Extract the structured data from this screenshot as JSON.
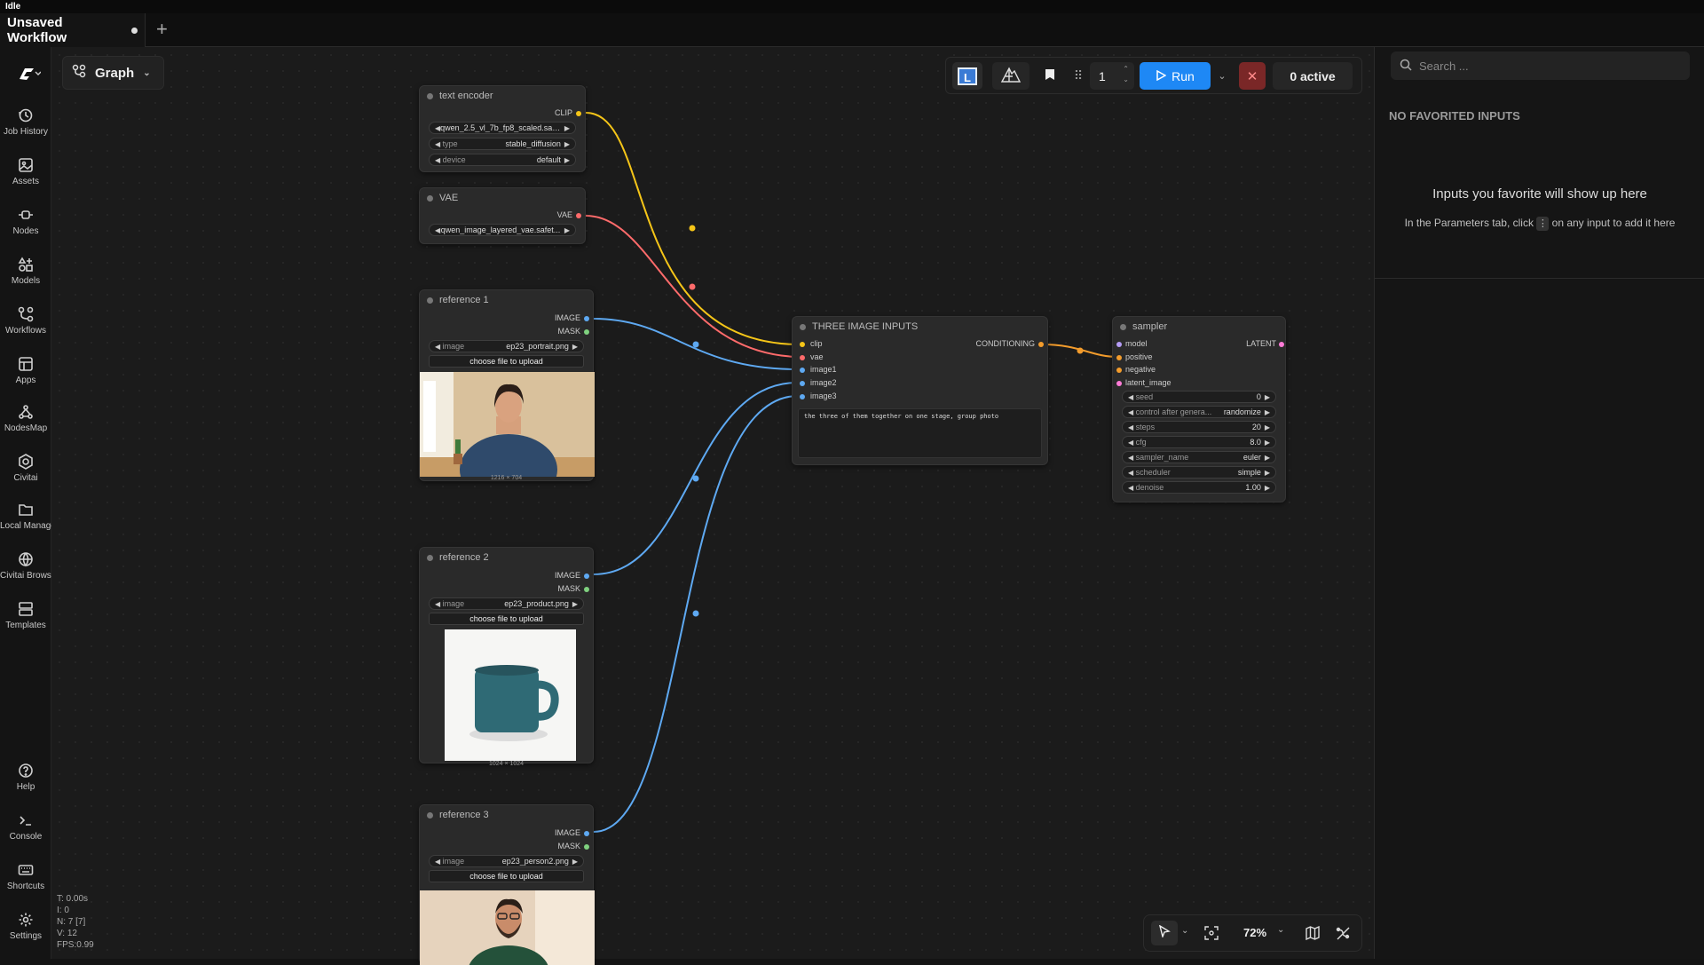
{
  "status_bar": {
    "text": "Idle"
  },
  "tabs": {
    "active_title": "Unsaved Workflow",
    "new_tab_icon": "plus-icon"
  },
  "sidebar": {
    "logo": "C",
    "items": [
      {
        "label": "Job History",
        "icon": "history-icon"
      },
      {
        "label": "Assets",
        "icon": "image-icon"
      },
      {
        "label": "Nodes",
        "icon": "nodes-icon"
      },
      {
        "label": "Models",
        "icon": "models-icon"
      },
      {
        "label": "Workflows",
        "icon": "workflow-icon"
      },
      {
        "label": "Apps",
        "icon": "apps-icon"
      },
      {
        "label": "NodesMap",
        "icon": "nodesmap-icon"
      },
      {
        "label": "Civitai",
        "icon": "civitai-icon"
      },
      {
        "label": "Local Manager",
        "icon": "folder-icon"
      },
      {
        "label": "Civitai Browser",
        "icon": "globe-icon"
      },
      {
        "label": "Templates",
        "icon": "templates-icon"
      }
    ],
    "bottom_items": [
      {
        "label": "Help",
        "icon": "help-icon"
      },
      {
        "label": "Console",
        "icon": "terminal-icon"
      },
      {
        "label": "Shortcuts",
        "icon": "keyboard-icon"
      },
      {
        "label": "Settings",
        "icon": "gear-icon"
      }
    ]
  },
  "graph_menu": {
    "label": "Graph"
  },
  "toolbar": {
    "queue_count": "1",
    "run_label": "Run",
    "active_label": "0 active"
  },
  "nodes": {
    "text_encoder": {
      "title": "text encoder",
      "output": "CLIP",
      "clip_name": "qwen_2.5_vl_7b_fp8_scaled.saf...",
      "type_label": "type",
      "type_value": "stable_diffusion",
      "device_label": "device",
      "device_value": "default"
    },
    "vae": {
      "title": "VAE",
      "output": "VAE",
      "vae_name": "qwen_image_layered_vae.safet..."
    },
    "ref1": {
      "title": "reference 1",
      "out_image": "IMAGE",
      "out_mask": "MASK",
      "image_label": "image",
      "image_value": "ep23_portrait.png",
      "upload": "choose file to upload",
      "caption": "1216 × 704"
    },
    "ref2": {
      "title": "reference 2",
      "out_image": "IMAGE",
      "out_mask": "MASK",
      "image_label": "image",
      "image_value": "ep23_product.png",
      "upload": "choose file to upload",
      "caption": "1024 × 1024"
    },
    "ref3": {
      "title": "reference 3",
      "out_image": "IMAGE",
      "out_mask": "MASK",
      "image_label": "image",
      "image_value": "ep23_person2.png",
      "upload": "choose file to upload"
    },
    "three": {
      "title": "THREE IMAGE INPUTS",
      "output": "CONDITIONING",
      "inputs": [
        "clip",
        "vae",
        "image1",
        "image2",
        "image3"
      ],
      "prompt": "the three of them together on one stage, group photo"
    },
    "sampler": {
      "title": "sampler",
      "output": "LATENT",
      "inputs": [
        "model",
        "positive",
        "negative",
        "latent_image"
      ],
      "widgets": [
        {
          "label": "seed",
          "value": "0"
        },
        {
          "label": "control after genera...",
          "value": "randomize"
        },
        {
          "label": "steps",
          "value": "20"
        },
        {
          "label": "cfg",
          "value": "8.0"
        },
        {
          "label": "sampler_name",
          "value": "euler"
        },
        {
          "label": "scheduler",
          "value": "simple"
        },
        {
          "label": "denoise",
          "value": "1.00"
        }
      ]
    }
  },
  "right_panel": {
    "search_placeholder": "Search ...",
    "heading": "NO FAVORITED INPUTS",
    "empty_title": "Inputs you favorite will show up here",
    "hint_before": "In the Parameters tab, click",
    "hint_after": "on any input to add it here"
  },
  "bottom_controls": {
    "zoom": "72%"
  },
  "stats": {
    "t": "T: 0.00s",
    "i": "I: 0",
    "n": "N: 7 [7]",
    "v": "V: 12",
    "fps": "FPS:0.99"
  },
  "colors": {
    "clip": "#f5c518",
    "vae": "#ff6b6b",
    "image": "#5ea9f2",
    "mask": "#7fd17f",
    "conditioning": "#f39c2c",
    "latent": "#ff7bd7",
    "run": "#1e88f5"
  }
}
